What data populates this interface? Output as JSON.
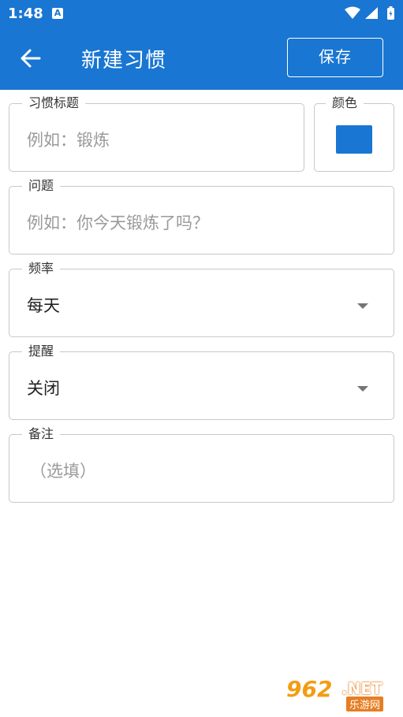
{
  "status_bar": {
    "time": "1:48",
    "notification_badge": "A",
    "icons": [
      "wifi-icon",
      "signal-icon",
      "battery-icon"
    ]
  },
  "app_bar": {
    "title": "新建习惯",
    "save_label": "保存",
    "back_icon": "arrow-left-icon",
    "color": "#1976d2"
  },
  "form": {
    "title_field": {
      "label": "习惯标题",
      "placeholder": "例如：锻炼"
    },
    "color_field": {
      "label": "颜色",
      "value": "#1976d2"
    },
    "question_field": {
      "label": "问题",
      "placeholder": "例如：你今天锻炼了吗？"
    },
    "frequency_field": {
      "label": "频率",
      "value": "每天"
    },
    "reminder_field": {
      "label": "提醒",
      "value": "关闭"
    },
    "notes_field": {
      "label": "备注",
      "placeholder": "（选填）"
    }
  },
  "watermark": {
    "number": "962",
    "domain": ".NET",
    "text": "乐游网"
  }
}
